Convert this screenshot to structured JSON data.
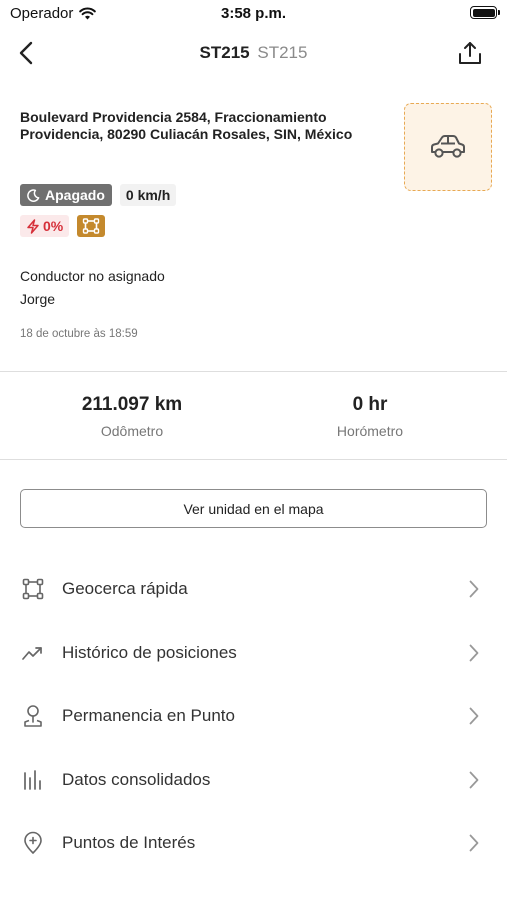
{
  "status_bar": {
    "carrier": "Operador",
    "time": "3:58 p.m."
  },
  "nav": {
    "title_id": "ST215",
    "title_sub": "ST215"
  },
  "vehicle": {
    "address_line1": "Boulevard Providencia 2584, Fraccionamiento",
    "address_line2": "Providencia, 80290 Culiacán Rosales, SIN, México",
    "status": "Apagado",
    "speed": "0 km/h",
    "battery": "0%",
    "driver_status": "Conductor no asignado",
    "driver_name": "Jorge",
    "last_update": "18 de octubre às 18:59"
  },
  "stats": {
    "odometer_value": "211.097 km",
    "odometer_label": "Odômetro",
    "hourmeter_value": "0 hr",
    "hourmeter_label": "Horómetro"
  },
  "map_button_label": "Ver unidad en el mapa",
  "menu": [
    {
      "label": "Geocerca rápida",
      "icon": "geofence-icon"
    },
    {
      "label": "Histórico de posiciones",
      "icon": "trend-icon"
    },
    {
      "label": "Permanencia en Punto",
      "icon": "location-pin-icon"
    },
    {
      "label": "Datos consolidados",
      "icon": "bar-chart-icon"
    },
    {
      "label": "Puntos de Interés",
      "icon": "poi-icon"
    }
  ],
  "colors": {
    "accent": "#e8a953",
    "vehicle_box_bg": "#fdf3e6",
    "status_off": "#707070",
    "battery_low": "#d6303a",
    "geofence_badge": "#c4892d"
  }
}
